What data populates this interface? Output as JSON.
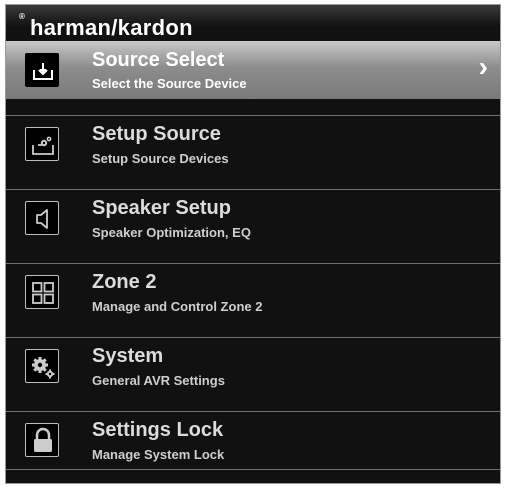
{
  "brand": {
    "name": "harman/kardon",
    "reg_mark": "®"
  },
  "menu": [
    {
      "title": "Source Select",
      "subtitle": "Select the Source Device",
      "icon": "source-select-icon",
      "selected": true
    },
    {
      "title": "Setup Source",
      "subtitle": "Setup Source Devices",
      "icon": "setup-source-icon",
      "selected": false
    },
    {
      "title": "Speaker Setup",
      "subtitle": "Speaker Optimization, EQ",
      "icon": "speaker-icon",
      "selected": false
    },
    {
      "title": "Zone 2",
      "subtitle": "Manage and Control Zone 2",
      "icon": "zone-grid-icon",
      "selected": false
    },
    {
      "title": "System",
      "subtitle": "General AVR Settings",
      "icon": "gears-icon",
      "selected": false
    },
    {
      "title": "Settings Lock",
      "subtitle": "Manage System Lock",
      "icon": "lock-icon",
      "selected": false
    }
  ],
  "colors": {
    "selected_bg": "#9a9a9a",
    "background": "#111111",
    "text": "#ffffff"
  }
}
